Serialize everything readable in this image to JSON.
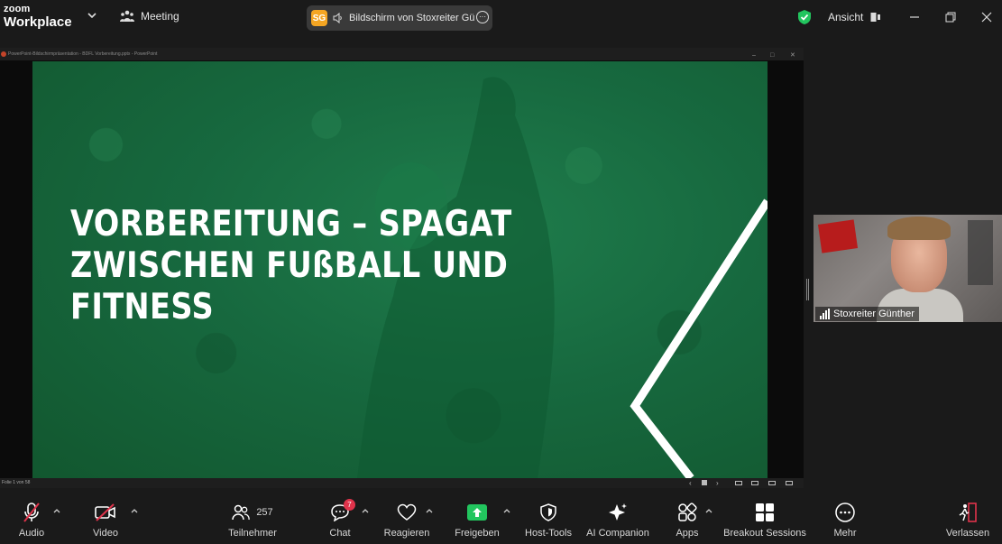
{
  "app": {
    "logo_small": "zoom",
    "logo_big": "Workplace",
    "meeting_label": "Meeting"
  },
  "share": {
    "badge": "SG",
    "text": "Bildschirm von Stoxreiter Gü"
  },
  "header": {
    "view_label": "Ansicht"
  },
  "ppt": {
    "title": "PowerPoint-Bildschirmpräsentation - BDFL Vorbereitung.pptx - PowerPoint",
    "status": "Folie 1 von 58"
  },
  "slide": {
    "title_lines": [
      "VORBEREITUNG – SPAGAT",
      "ZWISCHEN FUßBALL UND",
      "FITNESS"
    ]
  },
  "participant": {
    "name": "Stoxreiter Günther"
  },
  "toolbar": {
    "audio": "Audio",
    "video": "Video",
    "participants": "Teilnehmer",
    "participants_count": "257",
    "chat": "Chat",
    "chat_badge": "7",
    "react": "Reagieren",
    "share": "Freigeben",
    "host_tools": "Host-Tools",
    "ai_companion": "AI Companion",
    "apps": "Apps",
    "breakout": "Breakout Sessions",
    "more": "Mehr",
    "leave": "Verlassen"
  },
  "colors": {
    "accent_green": "#22c55e",
    "alert_red": "#e0334b",
    "slide_green": "#17693f",
    "share_orange": "#f5a623"
  }
}
